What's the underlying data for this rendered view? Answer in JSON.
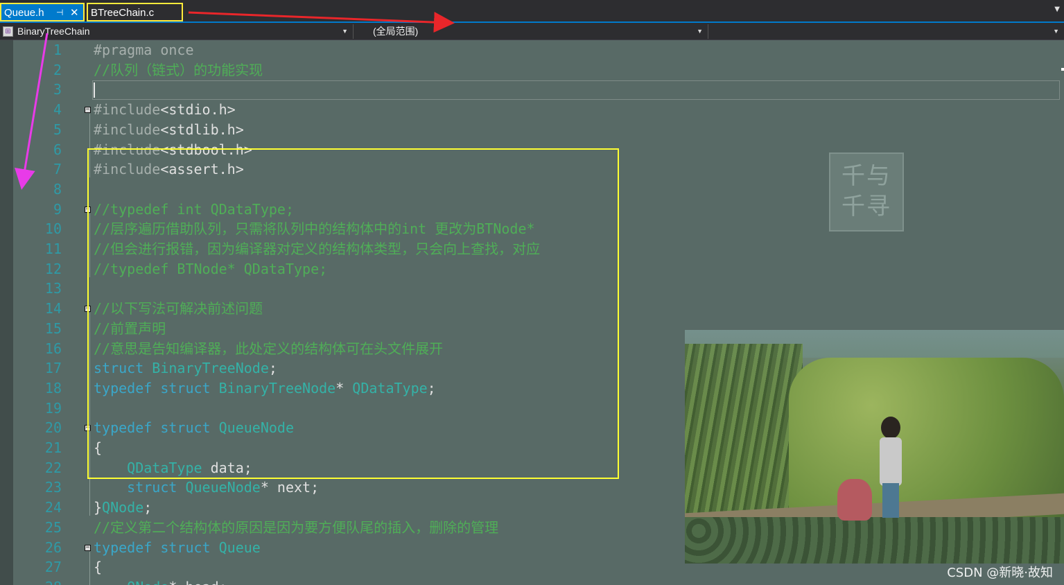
{
  "tabs": [
    {
      "label": "Queue.h",
      "pin_icon": "pin-icon",
      "close_icon": "close-icon",
      "active": true
    },
    {
      "label": "BTreeChain.c",
      "active": false
    }
  ],
  "navbar": {
    "project": "BinaryTreeChain",
    "scope": "(全局范围)",
    "member": ""
  },
  "code_lines": [
    {
      "n": "1",
      "parts": [
        [
          "pp",
          "#pragma once"
        ]
      ]
    },
    {
      "n": "2",
      "parts": [
        [
          "cm",
          "//队列（链式）的功能实现"
        ]
      ]
    },
    {
      "n": "3",
      "parts": []
    },
    {
      "n": "4",
      "parts": [
        [
          "pp",
          "#include"
        ],
        [
          "inc",
          "<stdio.h>"
        ]
      ]
    },
    {
      "n": "5",
      "parts": [
        [
          "pp",
          "#include"
        ],
        [
          "inc",
          "<stdlib.h>"
        ]
      ]
    },
    {
      "n": "6",
      "parts": [
        [
          "pp",
          "#include"
        ],
        [
          "inc",
          "<stdbool.h>"
        ]
      ]
    },
    {
      "n": "7",
      "parts": [
        [
          "pp",
          "#include"
        ],
        [
          "inc",
          "<assert.h>"
        ]
      ]
    },
    {
      "n": "8",
      "parts": []
    },
    {
      "n": "9",
      "parts": [
        [
          "cm",
          "//typedef int QDataType;"
        ]
      ]
    },
    {
      "n": "10",
      "parts": [
        [
          "cm",
          "//层序遍历借助队列，只需将队列中的结构体中的int 更改为BTNode*"
        ]
      ]
    },
    {
      "n": "11",
      "parts": [
        [
          "cm",
          "//但会进行报错，因为编译器对定义的结构体类型，只会向上查找，对应"
        ]
      ]
    },
    {
      "n": "12",
      "parts": [
        [
          "cm",
          "//typedef BTNode* QDataType;"
        ]
      ]
    },
    {
      "n": "13",
      "parts": []
    },
    {
      "n": "14",
      "parts": [
        [
          "cm",
          "//以下写法可解决前述问题"
        ]
      ]
    },
    {
      "n": "15",
      "parts": [
        [
          "cm",
          "//前置声明"
        ]
      ]
    },
    {
      "n": "16",
      "parts": [
        [
          "cm",
          "//意思是告知编译器，此处定义的结构体可在头文件展开"
        ]
      ]
    },
    {
      "n": "17",
      "parts": [
        [
          "kw",
          "struct "
        ],
        [
          "ty",
          "BinaryTreeNode"
        ],
        [
          "pl",
          ";"
        ]
      ]
    },
    {
      "n": "18",
      "parts": [
        [
          "kw",
          "typedef struct "
        ],
        [
          "ty",
          "BinaryTreeNode"
        ],
        [
          "pl",
          "* "
        ],
        [
          "ty",
          "QDataType"
        ],
        [
          "pl",
          ";"
        ]
      ]
    },
    {
      "n": "19",
      "parts": []
    },
    {
      "n": "20",
      "parts": [
        [
          "kw",
          "typedef struct "
        ],
        [
          "ty",
          "QueueNode"
        ]
      ]
    },
    {
      "n": "21",
      "parts": [
        [
          "pl",
          "{"
        ]
      ]
    },
    {
      "n": "22",
      "parts": [
        [
          "pl",
          "    "
        ],
        [
          "ty",
          "QDataType"
        ],
        [
          "pl",
          " data;"
        ]
      ]
    },
    {
      "n": "23",
      "parts": [
        [
          "pl",
          "    "
        ],
        [
          "kw",
          "struct "
        ],
        [
          "ty",
          "QueueNode"
        ],
        [
          "pl",
          "* next;"
        ]
      ]
    },
    {
      "n": "24",
      "parts": [
        [
          "pl",
          "}"
        ],
        [
          "ty",
          "QNode"
        ],
        [
          "pl",
          ";"
        ]
      ]
    },
    {
      "n": "25",
      "parts": [
        [
          "cm",
          "//定义第二个结构体的原因是因为要方便队尾的插入，删除的管理"
        ]
      ]
    },
    {
      "n": "26",
      "parts": [
        [
          "kw",
          "typedef struct "
        ],
        [
          "ty",
          "Queue"
        ]
      ]
    },
    {
      "n": "27",
      "parts": [
        [
          "pl",
          "{"
        ]
      ]
    },
    {
      "n": "28",
      "parts": [
        [
          "pl",
          "    "
        ],
        [
          "ty",
          "QNode"
        ],
        [
          "pl",
          "* head;"
        ]
      ]
    }
  ],
  "fold_lines": [
    "4",
    "9",
    "14",
    "20",
    "26"
  ],
  "seal_text": [
    "千与",
    "千寻"
  ],
  "watermark": "CSDN @新晓·故知",
  "colors": {
    "accent": "#007acc",
    "highlight_box": "#ffff33",
    "arrow_red": "#e8262a",
    "arrow_magenta": "#e83be8"
  }
}
